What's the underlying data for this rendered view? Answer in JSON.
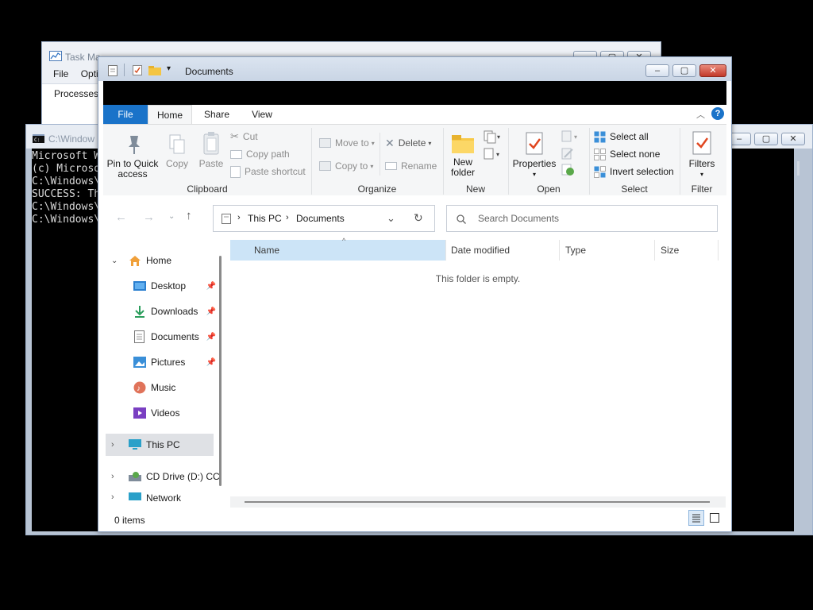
{
  "task_manager": {
    "title": "Task Ma",
    "menu": [
      "File",
      "Opti"
    ],
    "tab": "Processes"
  },
  "cmd": {
    "title": "C:\\Window",
    "lines": [
      "Microsoft W",
      "(c) Microso",
      "",
      "C:\\Windows\\",
      "SUCCESS: Th",
      "",
      "C:\\Windows\\",
      "",
      "C:\\Windows\\"
    ]
  },
  "explorer": {
    "title": "Documents",
    "ribbon_tabs": [
      "File",
      "Home",
      "Share",
      "View"
    ],
    "clipboard": {
      "pin_label_1": "Pin to Quick",
      "pin_label_2": "access",
      "copy": "Copy",
      "paste": "Paste",
      "cut": "Cut",
      "copy_path": "Copy path",
      "paste_shortcut": "Paste shortcut",
      "group": "Clipboard"
    },
    "organize": {
      "move_to": "Move to",
      "copy_to": "Copy to",
      "delete": "Delete",
      "rename": "Rename",
      "group": "Organize"
    },
    "new": {
      "new_folder_1": "New",
      "new_folder_2": "folder",
      "group": "New"
    },
    "open": {
      "properties": "Properties",
      "group": "Open"
    },
    "select": {
      "select_all": "Select all",
      "select_none": "Select none",
      "invert_selection": "Invert selection",
      "group": "Select"
    },
    "filter": {
      "filters": "Filters",
      "group": "Filter"
    },
    "address": {
      "this_pc": "This PC",
      "documents": "Documents"
    },
    "search": {
      "placeholder": "Search Documents"
    },
    "nav": {
      "home": "Home",
      "desktop": "Desktop",
      "downloads": "Downloads",
      "documents": "Documents",
      "pictures": "Pictures",
      "music": "Music",
      "videos": "Videos",
      "this_pc": "This PC",
      "cd_drive": "CD Drive (D:) CC",
      "network": "Network"
    },
    "columns": [
      "Name",
      "Date modified",
      "Type",
      "Size"
    ],
    "empty_message": "This folder is empty.",
    "status": "0 items",
    "colors": {
      "file_tab": "#1a73c9",
      "selection": "#cce4f7",
      "accent": "#0a64c8"
    }
  }
}
